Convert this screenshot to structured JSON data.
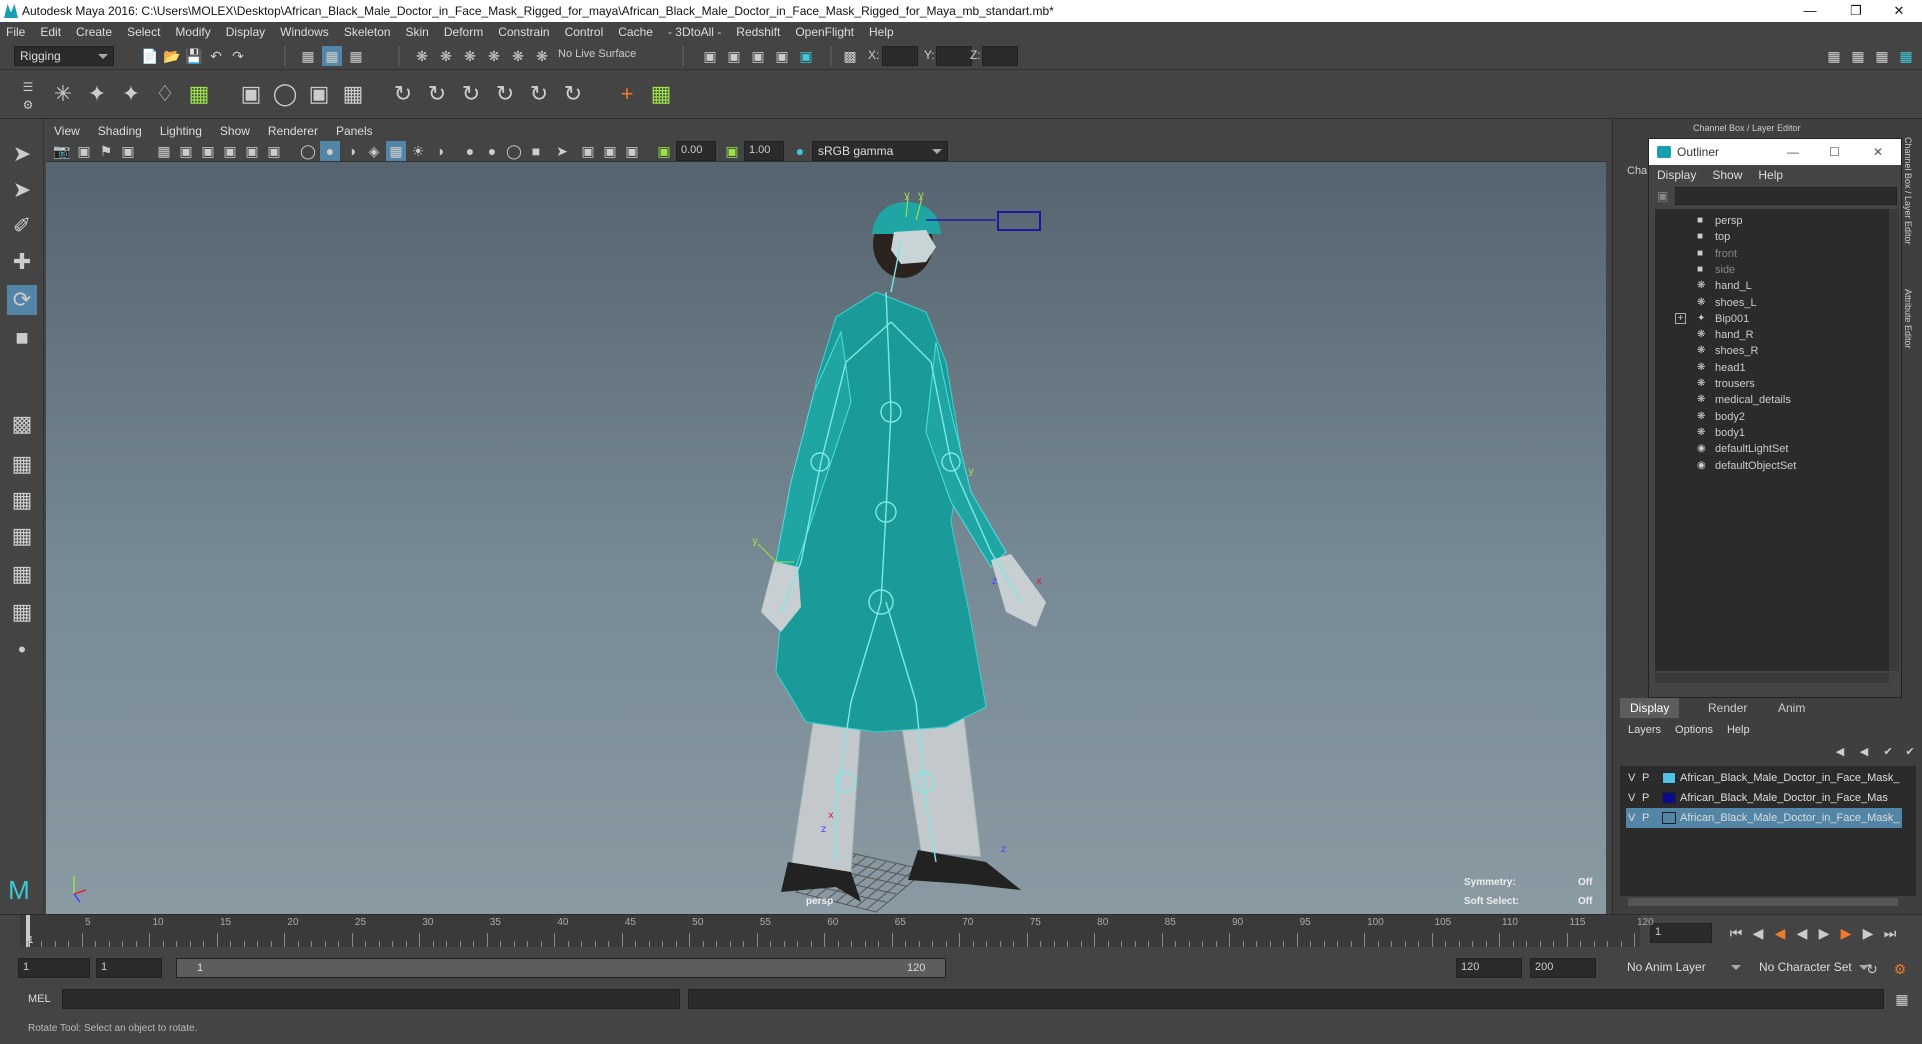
{
  "window": {
    "title": "Autodesk Maya 2016: C:\\Users\\MOLEX\\Desktop\\African_Black_Male_Doctor_in_Face_Mask_Rigged_for_maya\\African_Black_Male_Doctor_in_Face_Mask_Rigged_for_Maya_mb_standart.mb*"
  },
  "menubar": [
    "File",
    "Edit",
    "Create",
    "Select",
    "Modify",
    "Display",
    "Windows",
    "Skeleton",
    "Skin",
    "Deform",
    "Constrain",
    "Control",
    "Cache",
    "- 3DtoAll -",
    "Redshift",
    "OpenFlight",
    "Help"
  ],
  "status": {
    "mode": "Rigging",
    "live_surface": "No Live Surface",
    "x_label": "X:",
    "y_label": "Y:",
    "z_label": "Z:"
  },
  "viewport": {
    "menu": [
      "View",
      "Shading",
      "Lighting",
      "Show",
      "Renderer",
      "Panels"
    ],
    "field1": "0.00",
    "field2": "1.00",
    "colorspace": "sRGB gamma",
    "camera": "persp",
    "hud": {
      "symmetry_label": "Symmetry:",
      "symmetry_value": "Off",
      "soft_label": "Soft Select:",
      "soft_value": "Off"
    }
  },
  "rightpanel": {
    "header": "Channel Box / Layer Editor",
    "side_label": "Cha",
    "vertical_tabs": [
      "Channel Box / Layer Editor",
      "Attribute Editor"
    ]
  },
  "outliner": {
    "title": "Outliner",
    "menu": [
      "Display",
      "Show",
      "Help"
    ],
    "items": [
      {
        "label": "persp",
        "icon": "camera-icon",
        "dim": false
      },
      {
        "label": "top",
        "icon": "camera-icon",
        "dim": false
      },
      {
        "label": "front",
        "icon": "camera-icon",
        "dim": true
      },
      {
        "label": "side",
        "icon": "camera-icon",
        "dim": true
      },
      {
        "label": "hand_L",
        "icon": "mesh-icon",
        "dim": false
      },
      {
        "label": "shoes_L",
        "icon": "mesh-icon",
        "dim": false
      },
      {
        "label": "Bip001",
        "icon": "joint-icon",
        "dim": false,
        "expand": true
      },
      {
        "label": "hand_R",
        "icon": "mesh-icon",
        "dim": false
      },
      {
        "label": "shoes_R",
        "icon": "mesh-icon",
        "dim": false
      },
      {
        "label": "head1",
        "icon": "mesh-icon",
        "dim": false
      },
      {
        "label": "trousers",
        "icon": "mesh-icon",
        "dim": false
      },
      {
        "label": "medical_details",
        "icon": "mesh-icon",
        "dim": false
      },
      {
        "label": "body2",
        "icon": "mesh-icon",
        "dim": false
      },
      {
        "label": "body1",
        "icon": "mesh-icon",
        "dim": false
      },
      {
        "label": "defaultLightSet",
        "icon": "set-icon",
        "dim": false
      },
      {
        "label": "defaultObjectSet",
        "icon": "set-icon",
        "dim": false
      }
    ]
  },
  "layers": {
    "tabs": [
      "Display",
      "Render",
      "Anim"
    ],
    "menu": [
      "Layers",
      "Options",
      "Help"
    ],
    "rows": [
      {
        "v": "V",
        "p": "P",
        "name": "African_Black_Male_Doctor_in_Face_Mask_",
        "color": "#4fc3e6",
        "selected": false
      },
      {
        "v": "V",
        "p": "P",
        "name": "African_Black_Male_Doctor_in_Face_Mas",
        "color": "#0a0a8a",
        "selected": false
      },
      {
        "v": "V",
        "p": "P",
        "name": "African_Black_Male_Doctor_in_Face_Mask_",
        "color": "#5285a6",
        "selected": true
      }
    ]
  },
  "timeline": {
    "ticks": [
      "5",
      "10",
      "15",
      "20",
      "25",
      "30",
      "35",
      "40",
      "45",
      "50",
      "55",
      "60",
      "65",
      "70",
      "75",
      "80",
      "85",
      "90",
      "95",
      "100",
      "105",
      "110",
      "115",
      "120"
    ],
    "start_label": "1",
    "current_frame": "1"
  },
  "range": {
    "start": "1",
    "playback_start": "1",
    "slider_start": "1",
    "slider_end": "120",
    "end": "120",
    "anim_end": "200",
    "anim_layer": "No Anim Layer",
    "char_set": "No Character Set"
  },
  "cmd": {
    "label": "MEL"
  },
  "help": {
    "text": "Rotate Tool: Select an object to rotate."
  }
}
